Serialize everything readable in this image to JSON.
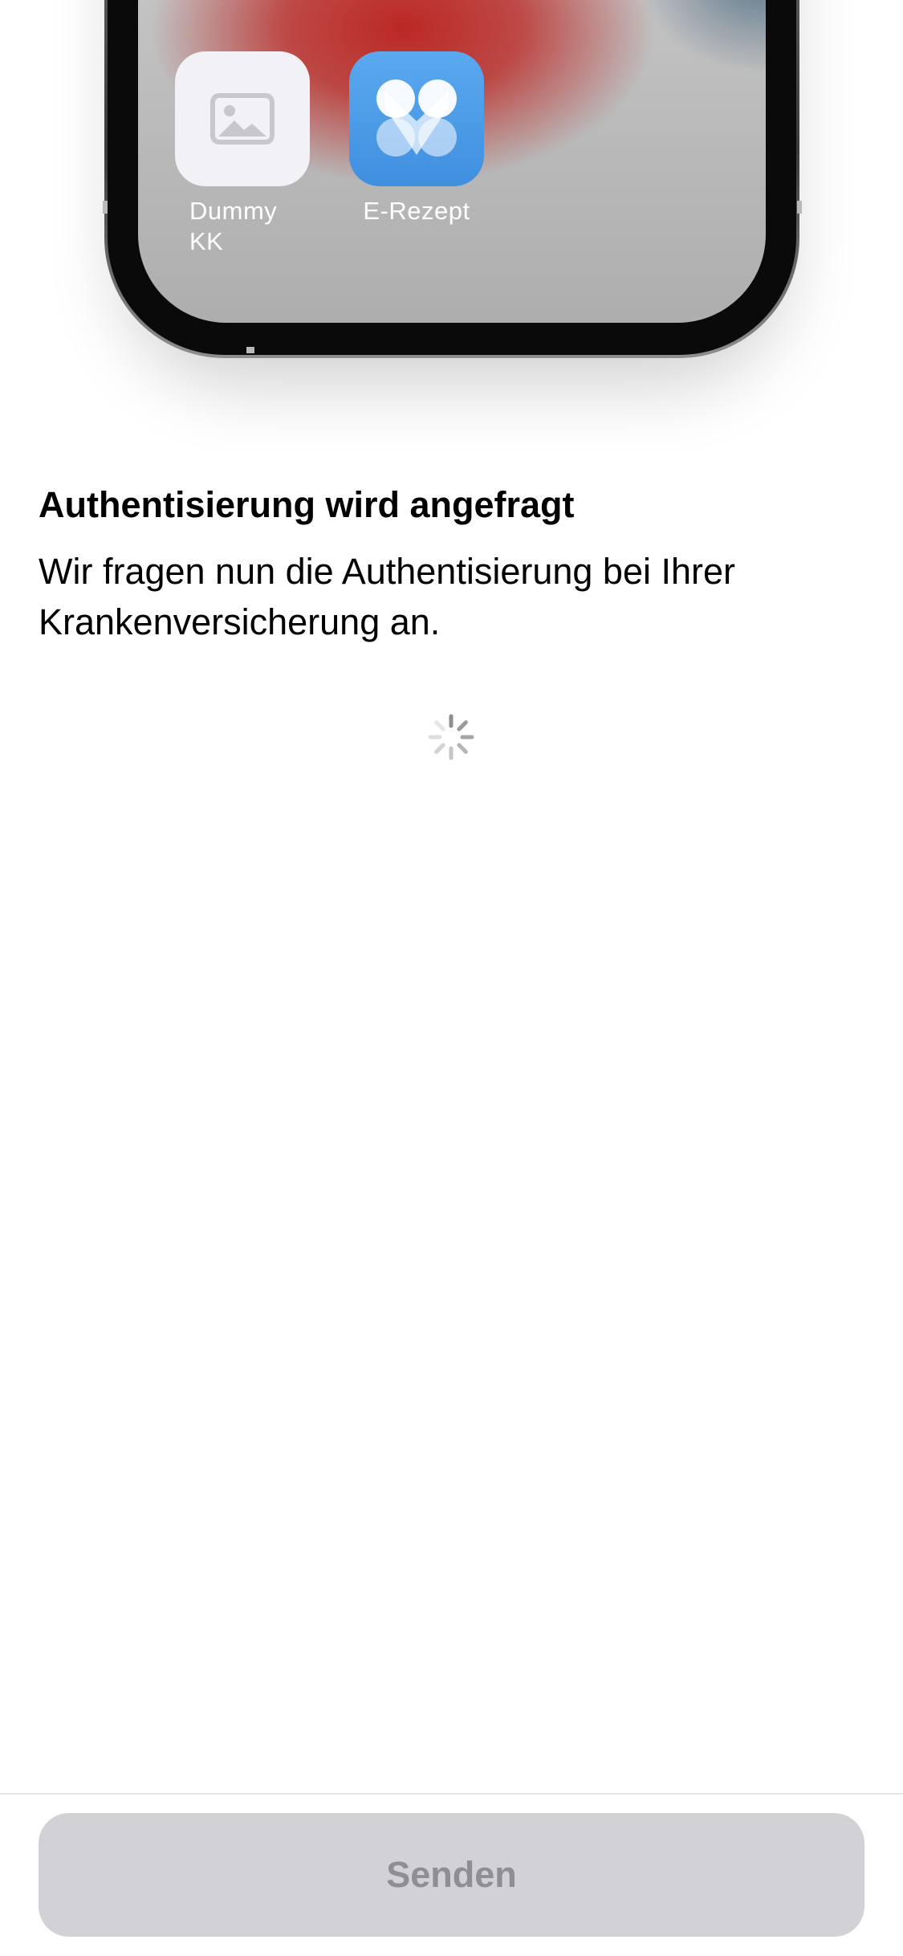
{
  "illustration": {
    "apps": [
      {
        "label_line1": "Dummy",
        "label_line2": "KK",
        "icon": "image-placeholder-icon"
      },
      {
        "label": "E-Rezept",
        "icon": "e-rezept-logo-icon"
      }
    ]
  },
  "content": {
    "title": "Authentisierung wird angefragt",
    "description": "Wir fragen nun die Authentisierung bei Ihrer Krankenversicherung an."
  },
  "actions": {
    "send_label": "Senden",
    "send_enabled": false
  },
  "colors": {
    "button_disabled_bg": "#d1d1d6",
    "button_disabled_text": "#8e8e93",
    "app_blue": "#4a9be8"
  }
}
